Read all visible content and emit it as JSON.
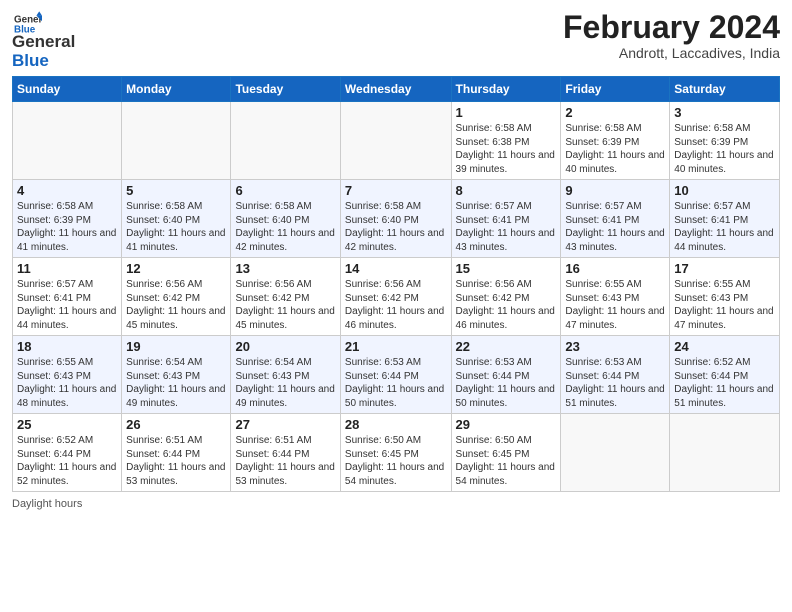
{
  "logo": {
    "line1": "General",
    "line2": "Blue"
  },
  "header": {
    "month": "February 2024",
    "location": "Andrott, Laccadives, India"
  },
  "weekdays": [
    "Sunday",
    "Monday",
    "Tuesday",
    "Wednesday",
    "Thursday",
    "Friday",
    "Saturday"
  ],
  "weeks": [
    [
      {
        "day": "",
        "info": ""
      },
      {
        "day": "",
        "info": ""
      },
      {
        "day": "",
        "info": ""
      },
      {
        "day": "",
        "info": ""
      },
      {
        "day": "1",
        "info": "Sunrise: 6:58 AM\nSunset: 6:38 PM\nDaylight: 11 hours and 39 minutes."
      },
      {
        "day": "2",
        "info": "Sunrise: 6:58 AM\nSunset: 6:39 PM\nDaylight: 11 hours and 40 minutes."
      },
      {
        "day": "3",
        "info": "Sunrise: 6:58 AM\nSunset: 6:39 PM\nDaylight: 11 hours and 40 minutes."
      }
    ],
    [
      {
        "day": "4",
        "info": "Sunrise: 6:58 AM\nSunset: 6:39 PM\nDaylight: 11 hours and 41 minutes."
      },
      {
        "day": "5",
        "info": "Sunrise: 6:58 AM\nSunset: 6:40 PM\nDaylight: 11 hours and 41 minutes."
      },
      {
        "day": "6",
        "info": "Sunrise: 6:58 AM\nSunset: 6:40 PM\nDaylight: 11 hours and 42 minutes."
      },
      {
        "day": "7",
        "info": "Sunrise: 6:58 AM\nSunset: 6:40 PM\nDaylight: 11 hours and 42 minutes."
      },
      {
        "day": "8",
        "info": "Sunrise: 6:57 AM\nSunset: 6:41 PM\nDaylight: 11 hours and 43 minutes."
      },
      {
        "day": "9",
        "info": "Sunrise: 6:57 AM\nSunset: 6:41 PM\nDaylight: 11 hours and 43 minutes."
      },
      {
        "day": "10",
        "info": "Sunrise: 6:57 AM\nSunset: 6:41 PM\nDaylight: 11 hours and 44 minutes."
      }
    ],
    [
      {
        "day": "11",
        "info": "Sunrise: 6:57 AM\nSunset: 6:41 PM\nDaylight: 11 hours and 44 minutes."
      },
      {
        "day": "12",
        "info": "Sunrise: 6:56 AM\nSunset: 6:42 PM\nDaylight: 11 hours and 45 minutes."
      },
      {
        "day": "13",
        "info": "Sunrise: 6:56 AM\nSunset: 6:42 PM\nDaylight: 11 hours and 45 minutes."
      },
      {
        "day": "14",
        "info": "Sunrise: 6:56 AM\nSunset: 6:42 PM\nDaylight: 11 hours and 46 minutes."
      },
      {
        "day": "15",
        "info": "Sunrise: 6:56 AM\nSunset: 6:42 PM\nDaylight: 11 hours and 46 minutes."
      },
      {
        "day": "16",
        "info": "Sunrise: 6:55 AM\nSunset: 6:43 PM\nDaylight: 11 hours and 47 minutes."
      },
      {
        "day": "17",
        "info": "Sunrise: 6:55 AM\nSunset: 6:43 PM\nDaylight: 11 hours and 47 minutes."
      }
    ],
    [
      {
        "day": "18",
        "info": "Sunrise: 6:55 AM\nSunset: 6:43 PM\nDaylight: 11 hours and 48 minutes."
      },
      {
        "day": "19",
        "info": "Sunrise: 6:54 AM\nSunset: 6:43 PM\nDaylight: 11 hours and 49 minutes."
      },
      {
        "day": "20",
        "info": "Sunrise: 6:54 AM\nSunset: 6:43 PM\nDaylight: 11 hours and 49 minutes."
      },
      {
        "day": "21",
        "info": "Sunrise: 6:53 AM\nSunset: 6:44 PM\nDaylight: 11 hours and 50 minutes."
      },
      {
        "day": "22",
        "info": "Sunrise: 6:53 AM\nSunset: 6:44 PM\nDaylight: 11 hours and 50 minutes."
      },
      {
        "day": "23",
        "info": "Sunrise: 6:53 AM\nSunset: 6:44 PM\nDaylight: 11 hours and 51 minutes."
      },
      {
        "day": "24",
        "info": "Sunrise: 6:52 AM\nSunset: 6:44 PM\nDaylight: 11 hours and 51 minutes."
      }
    ],
    [
      {
        "day": "25",
        "info": "Sunrise: 6:52 AM\nSunset: 6:44 PM\nDaylight: 11 hours and 52 minutes."
      },
      {
        "day": "26",
        "info": "Sunrise: 6:51 AM\nSunset: 6:44 PM\nDaylight: 11 hours and 53 minutes."
      },
      {
        "day": "27",
        "info": "Sunrise: 6:51 AM\nSunset: 6:44 PM\nDaylight: 11 hours and 53 minutes."
      },
      {
        "day": "28",
        "info": "Sunrise: 6:50 AM\nSunset: 6:45 PM\nDaylight: 11 hours and 54 minutes."
      },
      {
        "day": "29",
        "info": "Sunrise: 6:50 AM\nSunset: 6:45 PM\nDaylight: 11 hours and 54 minutes."
      },
      {
        "day": "",
        "info": ""
      },
      {
        "day": "",
        "info": ""
      }
    ]
  ],
  "footer": {
    "daylight_label": "Daylight hours"
  }
}
